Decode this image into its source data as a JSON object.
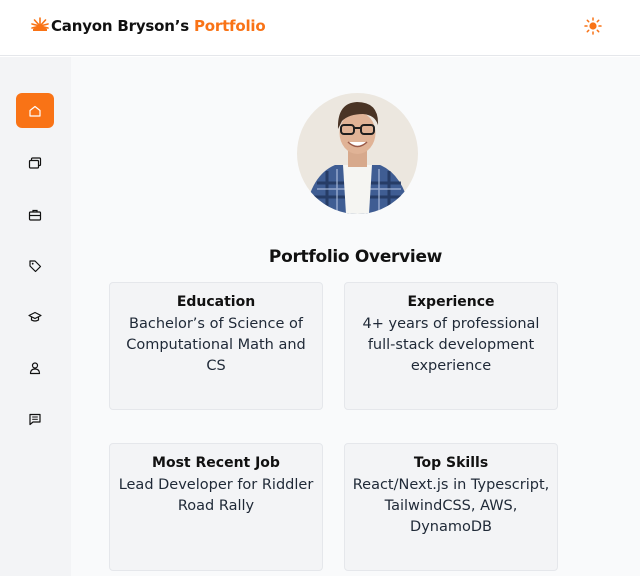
{
  "header": {
    "title_main": "Canyon Bryson’s",
    "title_accent": "Portfolio",
    "logo_icon": "sun-burst-icon",
    "theme_icon": "sun-icon"
  },
  "sidebar": {
    "items": [
      {
        "icon": "home-icon",
        "active": true
      },
      {
        "icon": "projects-icon",
        "active": false
      },
      {
        "icon": "briefcase-icon",
        "active": false
      },
      {
        "icon": "tag-icon",
        "active": false
      },
      {
        "icon": "graduation-cap-icon",
        "active": false
      },
      {
        "icon": "user-icon",
        "active": false
      },
      {
        "icon": "message-icon",
        "active": false
      }
    ]
  },
  "main": {
    "overview_title": "Portfolio Overview",
    "cards": [
      {
        "title": "Education",
        "body": "Bachelor’s of Science of Computational Math and CS"
      },
      {
        "title": "Experience",
        "body": "4+ years of professional full-stack development experience"
      },
      {
        "title": "Most Recent Job",
        "body": "Lead Developer for Riddler Road Rally"
      },
      {
        "title": "Top Skills",
        "body": "React/Next.js in Typescript, TailwindCSS, AWS, DynamoDB"
      }
    ]
  },
  "colors": {
    "accent": "#f97316",
    "sidebar_bg": "#f3f4f6",
    "main_bg": "#f9fafb",
    "card_bg": "#f3f4f6"
  }
}
